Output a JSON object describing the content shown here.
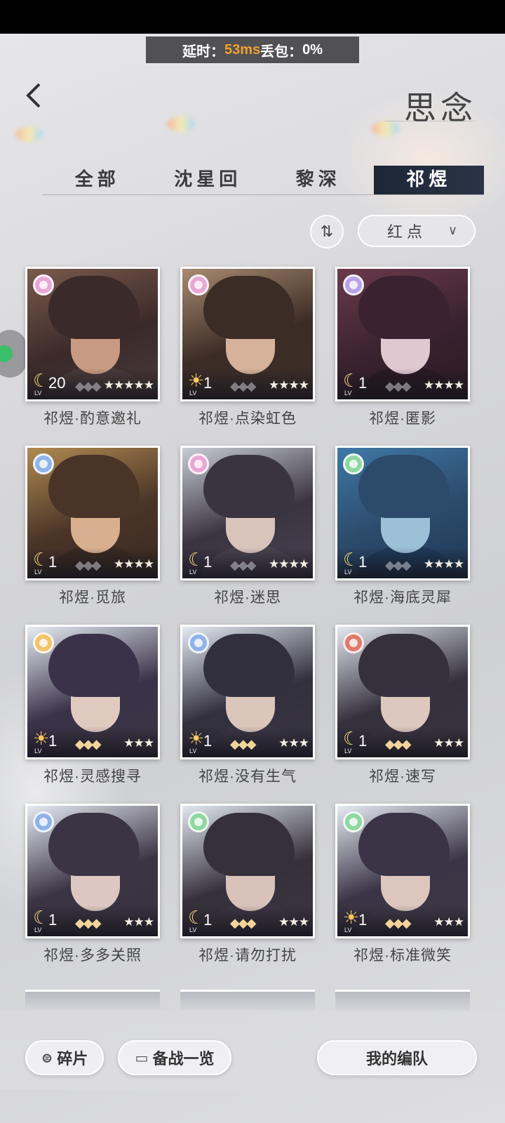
{
  "status_bar": {
    "delay_label": "延时：",
    "delay_value": "53ms",
    "loss_label": " 丢包：",
    "loss_value": "0%"
  },
  "header": {
    "title": "思念"
  },
  "tabs": [
    {
      "label": "全部",
      "active": false
    },
    {
      "label": "沈星回",
      "active": false
    },
    {
      "label": "黎深",
      "active": false
    },
    {
      "label": "祁煜",
      "active": true
    }
  ],
  "filter": {
    "sort_icon": "sort-toggle-icon",
    "selected": "红点"
  },
  "cards": [
    {
      "name": "祁煜·酌意邀礼",
      "level": "20",
      "phase": "moon",
      "attr_color": "#e9a7d4",
      "stars": "★★★★★",
      "emblem": "dim",
      "palette": [
        "#3b2a2a",
        "#c89a82",
        "#4a3a3a",
        "#7a5a4c"
      ]
    },
    {
      "name": "祁煜·点染虹色",
      "level": "1",
      "phase": "sun",
      "attr_color": "#e9a7d4",
      "stars": "★★★★",
      "emblem": "dim",
      "palette": [
        "#3b2c26",
        "#d6b29a",
        "#3d2e28",
        "#a88a70"
      ]
    },
    {
      "name": "祁煜·匿影",
      "level": "1",
      "phase": "moon",
      "attr_color": "#b9a2e8",
      "stars": "★★★★",
      "emblem": "dim",
      "palette": [
        "#3a2230",
        "#e0c8d0",
        "#2a1a22",
        "#6a3a4a"
      ]
    },
    {
      "name": "祁煜·觅旅",
      "level": "1",
      "phase": "moon",
      "attr_color": "#8fb3ea",
      "stars": "★★★★",
      "emblem": "dim",
      "palette": [
        "#4a3428",
        "#d8b090",
        "#3a2a22",
        "#b08a50"
      ]
    },
    {
      "name": "祁煜·迷思",
      "level": "1",
      "phase": "moon",
      "attr_color": "#e9a7d4",
      "stars": "★★★★",
      "emblem": "dim",
      "palette": [
        "#3a3440",
        "#d9c4bc",
        "#4a4250",
        "#c8ccd4"
      ]
    },
    {
      "name": "祁煜·海底灵犀",
      "level": "1",
      "phase": "moon",
      "attr_color": "#8ed8a2",
      "stars": "★★★★",
      "emblem": "dim",
      "palette": [
        "#2c4a6a",
        "#9cc0d8",
        "#1e3a58",
        "#3f78a6"
      ]
    },
    {
      "name": "祁煜·灵感搜寻",
      "level": "1",
      "phase": "sun",
      "attr_color": "#f2c36a",
      "stars": "★★★",
      "emblem": "bright",
      "palette": [
        "#3a3248",
        "#e0cac0",
        "#3c3444",
        "#e6ecf4"
      ]
    },
    {
      "name": "祁煜·没有生气",
      "level": "1",
      "phase": "sun",
      "attr_color": "#8fb3ea",
      "stars": "★★★",
      "emblem": "bright",
      "palette": [
        "#33303e",
        "#dcc6bc",
        "#3a3644",
        "#e4eaf2"
      ]
    },
    {
      "name": "祁煜·速写",
      "level": "1",
      "phase": "moon",
      "attr_color": "#e07a6a",
      "stars": "★★★",
      "emblem": "bright",
      "palette": [
        "#34303c",
        "#dcc8be",
        "#3a3440",
        "#e4e8f0"
      ]
    },
    {
      "name": "祁煜·多多关照",
      "level": "1",
      "phase": "moon",
      "attr_color": "#8fb3ea",
      "stars": "★★★",
      "emblem": "bright",
      "palette": [
        "#3a3444",
        "#dcc8c0",
        "#3a3440",
        "#e6eaf2"
      ]
    },
    {
      "name": "祁煜·请勿打扰",
      "level": "1",
      "phase": "moon",
      "attr_color": "#8ed8a2",
      "stars": "★★★",
      "emblem": "bright",
      "palette": [
        "#36303a",
        "#d8c2ba",
        "#3c3642",
        "#e2e8f0"
      ]
    },
    {
      "name": "祁煜·标准微笑",
      "level": "1",
      "phase": "sun",
      "attr_color": "#8ed8a2",
      "stars": "★★★",
      "emblem": "bright",
      "palette": [
        "#3a3446",
        "#dcc6be",
        "#3e3846",
        "#e6ebf3"
      ]
    }
  ],
  "bottom": {
    "fragments_label": "碎片",
    "prep_label": "备战一览",
    "team_label": "我的编队"
  }
}
